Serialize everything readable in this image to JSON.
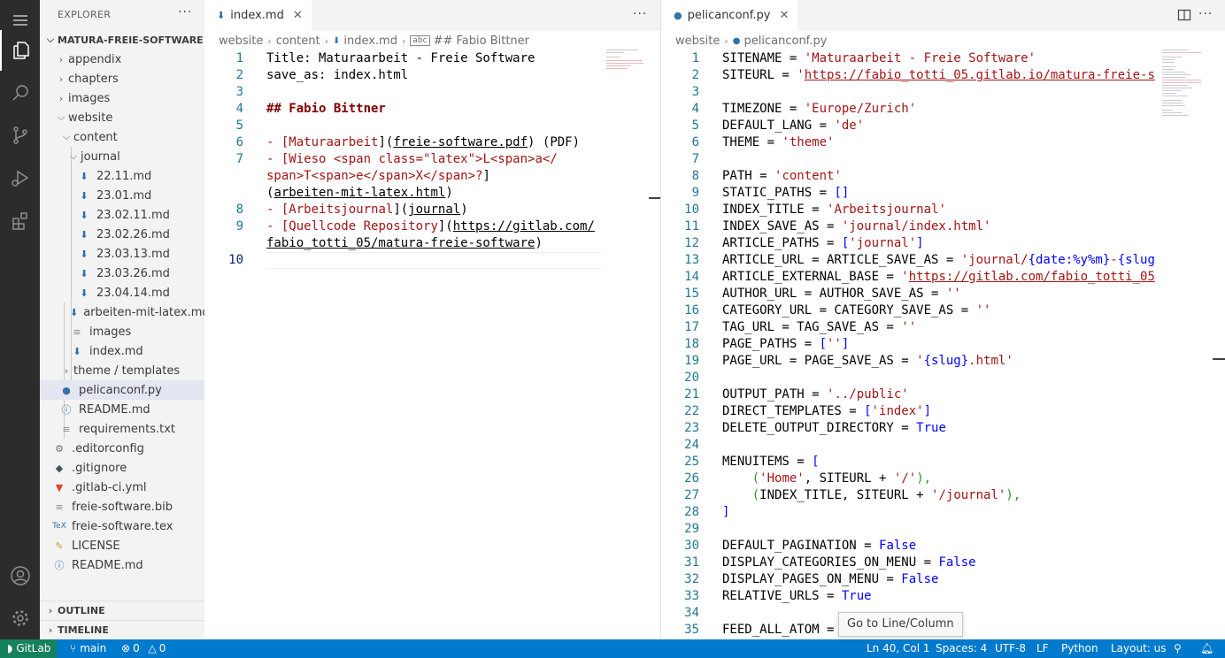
{
  "explorer": {
    "title": "EXPLORER",
    "more": "···",
    "root": "MATURA-FREIE-SOFTWARE",
    "items": [
      {
        "label": "appendix"
      },
      {
        "label": "chapters"
      },
      {
        "label": "images"
      },
      {
        "label": "website"
      },
      {
        "label": "content"
      },
      {
        "label": "journal"
      },
      {
        "label": "22.11.md"
      },
      {
        "label": "23.01.md"
      },
      {
        "label": "23.02.11.md"
      },
      {
        "label": "23.02.26.md"
      },
      {
        "label": "23.03.13.md"
      },
      {
        "label": "23.03.26.md"
      },
      {
        "label": "23.04.14.md"
      },
      {
        "label": "arbeiten-mit-latex.md"
      },
      {
        "label": "images"
      },
      {
        "label": "index.md"
      },
      {
        "label": "theme / templates"
      },
      {
        "label": "pelicanconf.py"
      },
      {
        "label": "README.md"
      },
      {
        "label": "requirements.txt"
      },
      {
        "label": ".editorconfig"
      },
      {
        "label": ".gitignore"
      },
      {
        "label": ".gitlab-ci.yml"
      },
      {
        "label": "freie-software.bib"
      },
      {
        "label": "freie-software.tex"
      },
      {
        "label": "LICENSE"
      },
      {
        "label": "README.md"
      }
    ],
    "outline": "OUTLINE",
    "timeline": "TIMELINE"
  },
  "left_editor": {
    "tab": "index.md",
    "close": "✕",
    "more": "···",
    "crumbs": [
      "website",
      "content",
      "index.md",
      "## Fabio Bittner"
    ],
    "line_numbers": [
      "1",
      "2",
      "3",
      "4",
      "5",
      "6",
      "7",
      "8",
      "9",
      "10"
    ],
    "lines": {
      "l1": "Title: Maturaarbeit - Freie Software",
      "l2": "save_as: index.html",
      "l4": "## Fabio Bittner",
      "l6a": "- [",
      "l6b": "Maturaarbeit",
      "l6c": "](",
      "l6d": "freie-software.pdf",
      "l6e": ") (PDF)",
      "l7a": "- [",
      "l7b": "Wieso <span class=\"latex\">L<span>a</",
      "l7c": "span>T<span>e</span>X</span>?",
      "l7d": "]",
      "l7e": "(",
      "l7f": "arbeiten-mit-latex.html",
      "l7g": ")",
      "l8a": "- [",
      "l8b": "Arbeitsjournal",
      "l8c": "](",
      "l8d": "journal",
      "l8e": ")",
      "l9a": "- [",
      "l9b": "Quellcode Repository",
      "l9c": "](",
      "l9d": "https://gitlab.com/",
      "l9e": "fabio_totti_05/matura-freie-software",
      "l9f": ")"
    }
  },
  "right_editor": {
    "tab": "pelicanconf.py",
    "close": "✕",
    "more": "···",
    "crumbs": [
      "website",
      "pelicanconf.py"
    ],
    "line_numbers": [
      "1",
      "2",
      "3",
      "4",
      "5",
      "6",
      "7",
      "8",
      "9",
      "10",
      "11",
      "12",
      "13",
      "14",
      "15",
      "16",
      "17",
      "18",
      "19",
      "20",
      "21",
      "22",
      "23",
      "24",
      "25",
      "26",
      "27",
      "28",
      "29",
      "30",
      "31",
      "32",
      "33",
      "34",
      "35"
    ],
    "code": {
      "c1a": "SITENAME = ",
      "c1b": "'Maturaarbeit - Freie Software'",
      "c2a": "SITEURL = ",
      "c2b": "'",
      "c2c": "https://fabio_totti_05.gitlab.io/matura-freie-s",
      "c4a": "TIMEZONE = ",
      "c4b": "'Europe/Zurich'",
      "c5a": "DEFAULT_LANG = ",
      "c5b": "'de'",
      "c6a": "THEME = ",
      "c6b": "'theme'",
      "c8a": "PATH = ",
      "c8b": "'content'",
      "c9a": "STATIC_PATHS = ",
      "c9b": "[]",
      "c10a": "INDEX_TITLE = ",
      "c10b": "'Arbeitsjournal'",
      "c11a": "INDEX_SAVE_AS = ",
      "c11b": "'journal/index.html'",
      "c12a": "ARTICLE_PATHS = ",
      "c12b": "[",
      "c12c": "'journal'",
      "c12d": "]",
      "c13a": "ARTICLE_URL = ARTICLE_SAVE_AS = ",
      "c13b": "'journal/",
      "c13c": "{date:%y%m}",
      "c13d": "-",
      "c13e": "{slug",
      "c14a": "ARTICLE_EXTERNAL_BASE = ",
      "c14b": "'",
      "c14c": "https://gitlab.com/fabio_totti_05",
      "c15a": "AUTHOR_URL = AUTHOR_SAVE_AS = ",
      "c15b": "''",
      "c16a": "CATEGORY_URL = CATEGORY_SAVE_AS = ",
      "c16b": "''",
      "c17a": "TAG_URL = TAG_SAVE_AS = ",
      "c17b": "''",
      "c18a": "PAGE_PATHS = ",
      "c18b": "[",
      "c18c": "''",
      "c18d": "]",
      "c19a": "PAGE_URL = PAGE_SAVE_AS = ",
      "c19b": "'",
      "c19c": "{slug}",
      "c19d": ".html'",
      "c21a": "OUTPUT_PATH = ",
      "c21b": "'../public'",
      "c22a": "DIRECT_TEMPLATES = ",
      "c22b": "[",
      "c22c": "'index'",
      "c22d": "]",
      "c23a": "DELETE_OUTPUT_DIRECTORY = ",
      "c23b": "True",
      "c25a": "MENUITEMS = ",
      "c25b": "[",
      "c26a": "    (",
      "c26b": "'Home'",
      "c26c": ", SITEURL + ",
      "c26d": "'/'",
      "c26e": "),",
      "c27a": "    (",
      "c27b": "INDEX_TITLE, SITEURL + ",
      "c27c": "'/journal'",
      "c27d": "),",
      "c28a": "]",
      "c30a": "DEFAULT_PAGINATION = ",
      "c30b": "False",
      "c31a": "DISPLAY_CATEGORIES_ON_MENU = ",
      "c31b": "False",
      "c32a": "DISPLAY_PAGES_ON_MENU = ",
      "c32b": "False",
      "c33a": "RELATIVE_URLS = ",
      "c33b": "True",
      "c35a": "FEED_ALL_ATOM = "
    }
  },
  "tooltip": "Go to Line/Column",
  "status": {
    "remote": "GitLab",
    "branch": "main",
    "errors": "0",
    "warnings": "0",
    "position": "Ln 40, Col 1",
    "spaces": "Spaces: 4",
    "encoding": "UTF-8",
    "eol": "LF",
    "language": "Python",
    "layout": "Layout: us"
  },
  "colors": {
    "status_bar": "#007acc",
    "activity_bar": "#2c2c2c",
    "sidebar": "#f3f3f3",
    "string": "#a31515",
    "keyword": "#0000ff",
    "line_number": "#237893"
  }
}
